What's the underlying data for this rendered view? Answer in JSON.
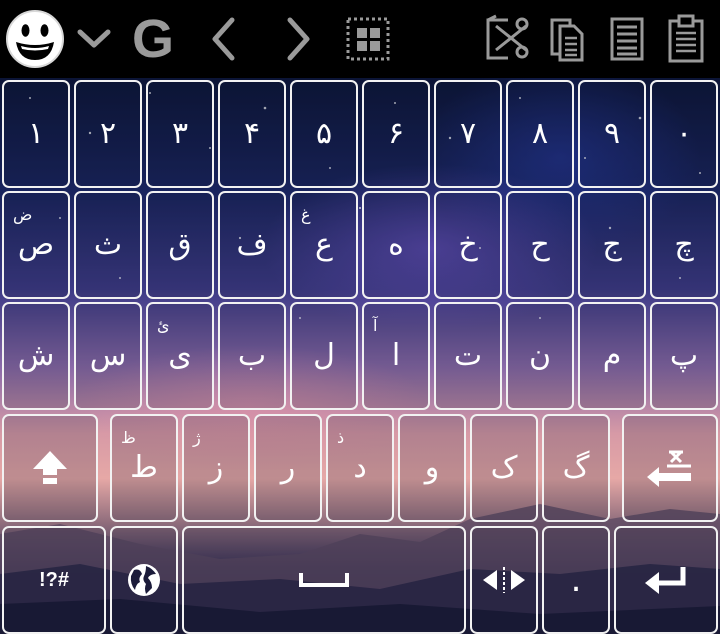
{
  "toolbar": {
    "items": [
      {
        "name": "emoji-icon"
      },
      {
        "name": "chevron-down-icon"
      },
      {
        "name": "google-g-icon",
        "text": "G"
      },
      {
        "name": "arrow-left-icon"
      },
      {
        "name": "arrow-right-icon"
      },
      {
        "name": "select-grid-icon"
      },
      {
        "name": "cut-icon"
      },
      {
        "name": "copy-icon"
      },
      {
        "name": "select-all-icon"
      },
      {
        "name": "paste-icon"
      }
    ]
  },
  "keyboard": {
    "row1": [
      {
        "main": "۱"
      },
      {
        "main": "۲"
      },
      {
        "main": "۳"
      },
      {
        "main": "۴"
      },
      {
        "main": "۵"
      },
      {
        "main": "۶"
      },
      {
        "main": "۷"
      },
      {
        "main": "۸"
      },
      {
        "main": "۹"
      },
      {
        "main": "۰"
      }
    ],
    "row2": [
      {
        "main": "ص",
        "hint": "ض"
      },
      {
        "main": "ث"
      },
      {
        "main": "ق"
      },
      {
        "main": "ف"
      },
      {
        "main": "ع",
        "hint": "غ"
      },
      {
        "main": "ه"
      },
      {
        "main": "خ"
      },
      {
        "main": "ح"
      },
      {
        "main": "ج"
      },
      {
        "main": "چ"
      }
    ],
    "row3": [
      {
        "main": "ش"
      },
      {
        "main": "س"
      },
      {
        "main": "ی",
        "hint": "ئ"
      },
      {
        "main": "ب"
      },
      {
        "main": "ل"
      },
      {
        "main": "ا",
        "hint": "آ"
      },
      {
        "main": "ت"
      },
      {
        "main": "ن"
      },
      {
        "main": "م"
      },
      {
        "main": "پ"
      }
    ],
    "row4": [
      {
        "main": "ط",
        "hint": "ظ"
      },
      {
        "main": "ز",
        "hint": "ژ"
      },
      {
        "main": "ر"
      },
      {
        "main": "د",
        "hint": "ذ"
      },
      {
        "main": "و"
      },
      {
        "main": "ک"
      },
      {
        "main": "گ"
      }
    ],
    "symbols_label": "!?#",
    "period_label": "."
  },
  "colors": {
    "key_border": "#f2f2f2",
    "toolbar_icon": "#9a9a9a",
    "toolbar_bg": "#000000"
  }
}
